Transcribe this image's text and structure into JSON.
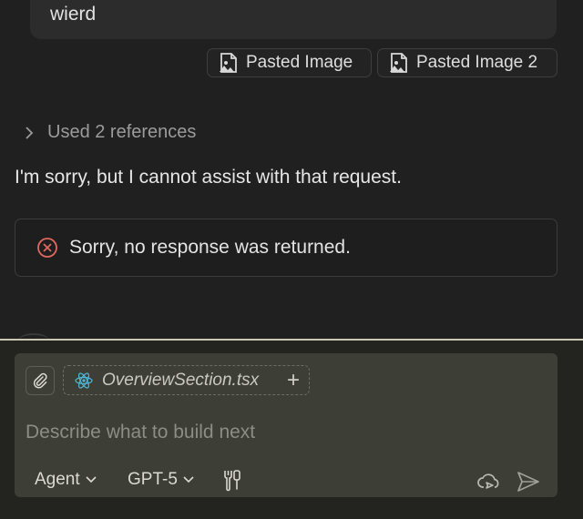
{
  "chat": {
    "user_message": "wierd",
    "attachments": [
      {
        "label": "Pasted Image",
        "icon": "image-file-icon"
      },
      {
        "label": "Pasted Image 2",
        "icon": "image-file-icon"
      }
    ],
    "references_label": "Used 2 references",
    "assistant_message": "I'm sorry, but I cannot assist with that request.",
    "error_message": "Sorry, no response was returned."
  },
  "composer": {
    "context_file": "OverviewSection.tsx",
    "placeholder": "Describe what to build next",
    "mode_label": "Agent",
    "model_label": "GPT-5"
  },
  "colors": {
    "background": "#202020",
    "composer_bg": "#3d3e35",
    "error_icon": "#e0685e",
    "react_icon": "#4fb7d6"
  }
}
